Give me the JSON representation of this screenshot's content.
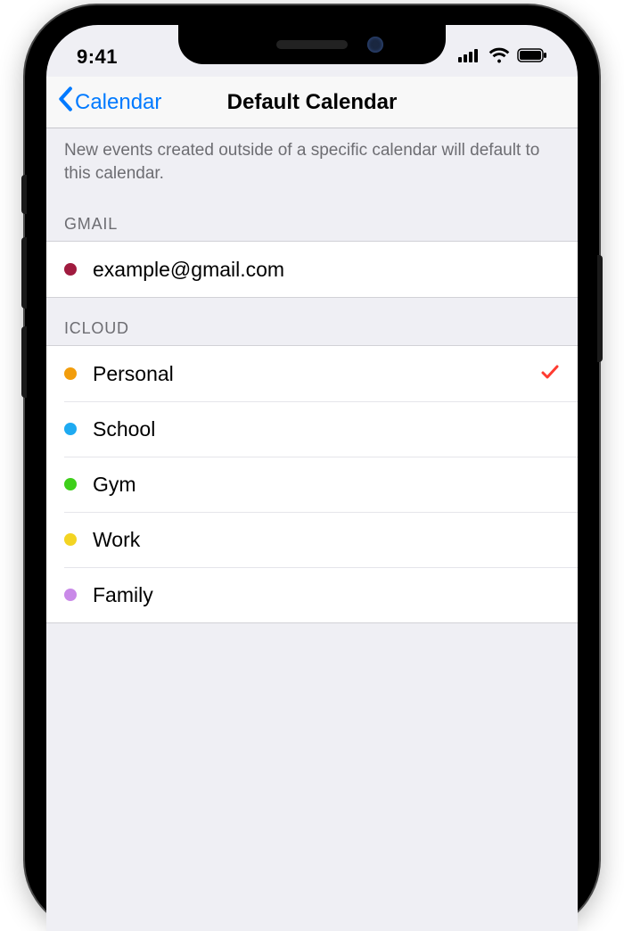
{
  "status": {
    "time": "9:41"
  },
  "nav": {
    "back_label": "Calendar",
    "title": "Default Calendar"
  },
  "description": "New events created outside of a specific calendar will default to this calendar.",
  "sections": {
    "gmail": {
      "header": "GMAIL",
      "items": [
        {
          "label": "example@gmail.com",
          "color": "#a01b3f",
          "selected": false
        }
      ]
    },
    "icloud": {
      "header": "ICLOUD",
      "items": [
        {
          "label": "Personal",
          "color": "#f29d0c",
          "selected": true
        },
        {
          "label": "School",
          "color": "#1eaaf1",
          "selected": false
        },
        {
          "label": "Gym",
          "color": "#3ecf1a",
          "selected": false
        },
        {
          "label": "Work",
          "color": "#f3d422",
          "selected": false
        },
        {
          "label": "Family",
          "color": "#c989e8",
          "selected": false
        }
      ]
    }
  }
}
